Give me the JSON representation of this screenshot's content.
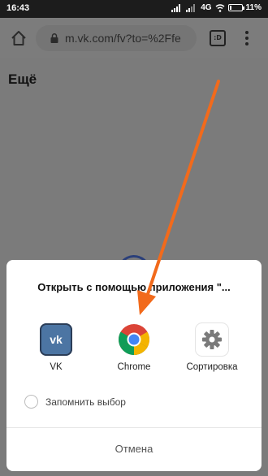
{
  "status_bar": {
    "time": "16:43",
    "network": "4G",
    "battery": "11%"
  },
  "browser": {
    "url": "m.vk.com/fv?to=%2Ffe",
    "tabs_label": ":D"
  },
  "page": {
    "heading": "Ещё"
  },
  "dialog": {
    "title": "Открыть с помощью приложения \"...",
    "apps": [
      {
        "label": "VK",
        "icon": "vk-icon"
      },
      {
        "label": "Chrome",
        "icon": "chrome-icon"
      },
      {
        "label": "Сортировка",
        "icon": "gear-icon"
      }
    ],
    "vk_icon_text": "vk",
    "remember_label": "Запомнить выбор",
    "cancel_label": "Отмена"
  },
  "colors": {
    "arrow": "#f26a1b",
    "vk": "#4c75a3",
    "overlay": "#7b7b7b"
  }
}
